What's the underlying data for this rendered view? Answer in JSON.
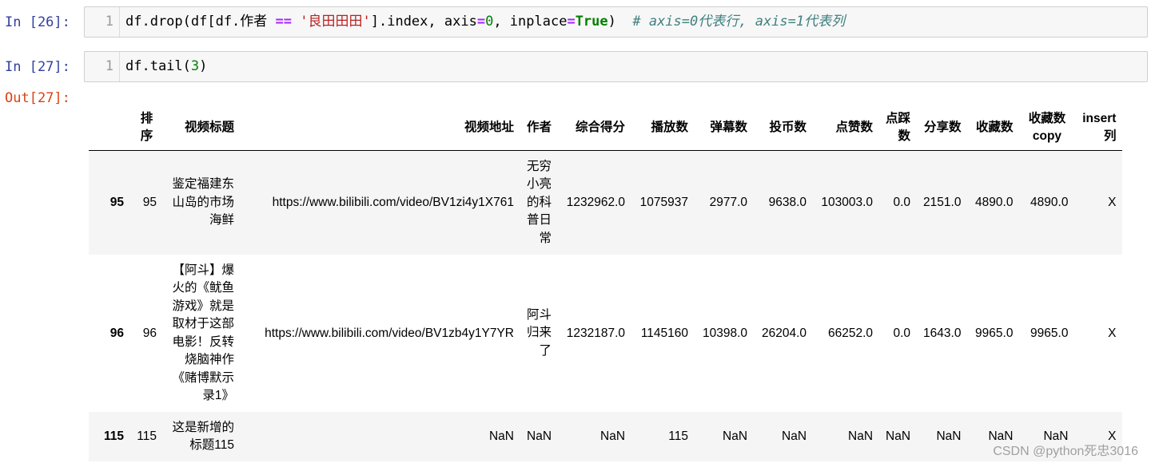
{
  "cells": [
    {
      "prompt": "In [26]:",
      "line_no": "1",
      "code": {
        "p1": "df.drop(df[df.作者 ",
        "op1": "==",
        "p2": " ",
        "str1": "'良田田田'",
        "p3": "].index, axis",
        "op2": "=",
        "num1": "0",
        "p4": ", inplace",
        "op3": "=",
        "bool1": "True",
        "p5": ")  ",
        "comment": "# axis=0代表行, axis=1代表列"
      }
    },
    {
      "prompt": "In [27]:",
      "line_no": "1",
      "code": {
        "p1": "df.tail(",
        "num1": "3",
        "p2": ")"
      }
    }
  ],
  "output": {
    "prompt": "Out[27]:",
    "columns": [
      "",
      "排序",
      "视频标题",
      "视频地址",
      "作者",
      "综合得分",
      "播放数",
      "弹幕数",
      "投币数",
      "点赞数",
      "点踩数",
      "分享数",
      "收藏数",
      "收藏数copy",
      "insert列"
    ],
    "column_display": {
      "h1": "排<br>序",
      "h10": "点踩<br>数",
      "h13": "收藏数<br>copy",
      "h14": "insert<br>列"
    },
    "rows": [
      {
        "index": "95",
        "rank": "95",
        "title": "鉴定福建东山岛的市场海鲜",
        "url": "https://www.bilibili.com/video/BV1zi4y1X761",
        "author": "无穷小亮的科普日常",
        "score": "1232962.0",
        "plays": "1075937",
        "danmaku": "2977.0",
        "coins": "9638.0",
        "likes": "103003.0",
        "dislikes": "0.0",
        "shares": "2151.0",
        "favorites": "4890.0",
        "favorites_copy": "4890.0",
        "insert": "X"
      },
      {
        "index": "96",
        "rank": "96",
        "title": "【阿斗】爆火的《鱿鱼游戏》就是取材于这部电影！反转烧脑神作《赌博默示录1》",
        "url": "https://www.bilibili.com/video/BV1zb4y1Y7YR",
        "author": "阿斗归来了",
        "score": "1232187.0",
        "plays": "1145160",
        "danmaku": "10398.0",
        "coins": "26204.0",
        "likes": "66252.0",
        "dislikes": "0.0",
        "shares": "1643.0",
        "favorites": "9965.0",
        "favorites_copy": "9965.0",
        "insert": "X"
      },
      {
        "index": "115",
        "rank": "115",
        "title": "这是新增的标题115",
        "url": "NaN",
        "author": "NaN",
        "score": "NaN",
        "plays": "115",
        "danmaku": "NaN",
        "coins": "NaN",
        "likes": "NaN",
        "dislikes": "NaN",
        "shares": "NaN",
        "favorites": "NaN",
        "favorites_copy": "NaN",
        "insert": "X"
      }
    ]
  },
  "watermark": "CSDN @python死忠3016"
}
